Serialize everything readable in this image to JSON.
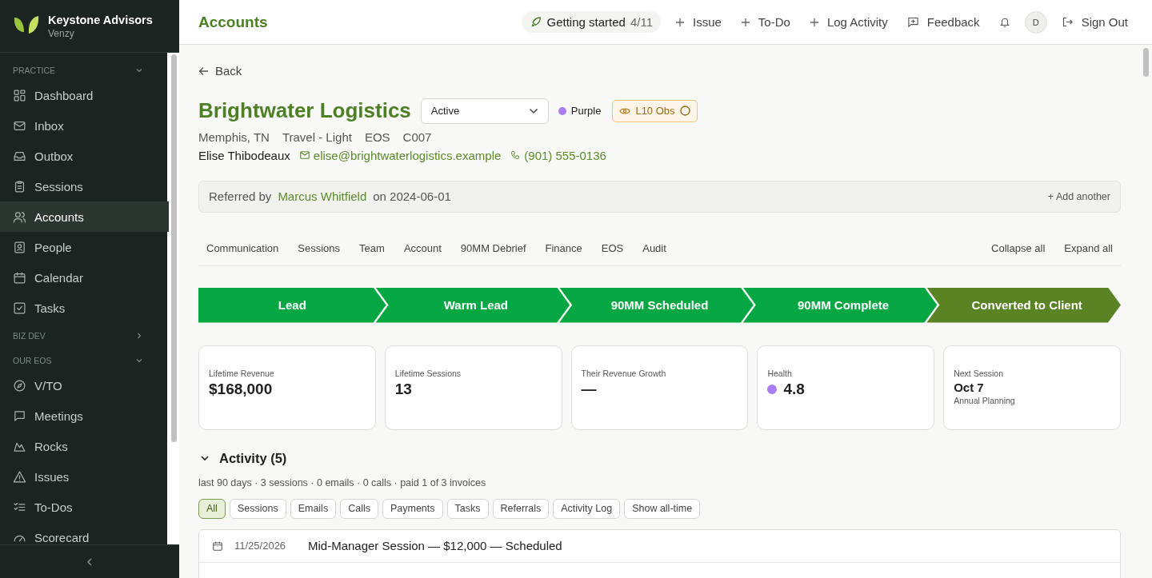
{
  "org": {
    "name": "Keystone Advisors",
    "product": "Venzy"
  },
  "sidebar": {
    "sections": [
      {
        "label": "PRACTICE",
        "expanded": true,
        "items": [
          {
            "label": "Dashboard",
            "selected": false
          },
          {
            "label": "Inbox",
            "selected": false
          },
          {
            "label": "Outbox",
            "selected": false
          },
          {
            "label": "Sessions",
            "selected": false
          },
          {
            "label": "Accounts",
            "selected": true
          },
          {
            "label": "People",
            "selected": false
          },
          {
            "label": "Calendar",
            "selected": false
          },
          {
            "label": "Tasks",
            "selected": false
          }
        ]
      },
      {
        "label": "BIZ DEV",
        "expanded": false
      },
      {
        "label": "OUR EOS",
        "expanded": true,
        "items": [
          {
            "label": "V/TO",
            "selected": false
          },
          {
            "label": "Meetings",
            "selected": false
          },
          {
            "label": "Rocks",
            "selected": false
          },
          {
            "label": "Issues",
            "selected": false
          },
          {
            "label": "To-Dos",
            "selected": false
          },
          {
            "label": "Scorecard",
            "selected": false
          }
        ]
      }
    ]
  },
  "header": {
    "title": "Accounts",
    "getting_started": {
      "label": "Getting started",
      "progress": "4/11"
    },
    "actions": [
      "Issue",
      "To-Do",
      "Log Activity"
    ],
    "feedback": "Feedback",
    "avatar": "D",
    "sign_out": "Sign Out"
  },
  "back": "Back",
  "account": {
    "name": "Brightwater Logistics",
    "status": "Active",
    "tag": {
      "label": "Purple",
      "color": "#a87ef0"
    },
    "badge": "L10 Obs",
    "meta": [
      "Memphis, TN",
      "Travel - Light",
      "EOS",
      "C007"
    ],
    "contact": {
      "name": "Elise Thibodeaux",
      "email": "elise@brightwaterlogistics.example",
      "phone": "(901) 555-0136"
    }
  },
  "referral": {
    "prefix": "Referred by",
    "name": "Marcus Whitfield",
    "date": "on 2024-06-01",
    "add": "+ Add another"
  },
  "section_tabs": [
    "Communication",
    "Sessions",
    "Team",
    "Account",
    "90MM Debrief",
    "Finance",
    "EOS",
    "Audit"
  ],
  "section_actions": [
    "Collapse all",
    "Expand all"
  ],
  "stages": [
    {
      "label": "Lead",
      "selected": false
    },
    {
      "label": "Warm Lead",
      "selected": false
    },
    {
      "label": "90MM Scheduled",
      "selected": false
    },
    {
      "label": "90MM Complete",
      "selected": false
    },
    {
      "label": "Converted to Client",
      "selected": true
    }
  ],
  "stats": [
    {
      "label": "Lifetime Revenue",
      "value": "$168,000"
    },
    {
      "label": "Lifetime Sessions",
      "value": "13"
    },
    {
      "label": "Their Revenue Growth",
      "value": "—"
    },
    {
      "label": "Health",
      "value": "4.8",
      "color": "#a87ef0"
    },
    {
      "label": "Next Session",
      "value": "Oct 7",
      "note": "Annual Planning"
    }
  ],
  "activity": {
    "title": "Activity (5)",
    "expanded": true,
    "summary": "last 90 days · 3 sessions · 0 emails · 0 calls · paid 1 of 3 invoices",
    "filters": [
      {
        "label": "All",
        "selected": true
      },
      {
        "label": "Sessions",
        "selected": false
      },
      {
        "label": "Emails",
        "selected": false
      },
      {
        "label": "Calls",
        "selected": false
      },
      {
        "label": "Payments",
        "selected": false
      },
      {
        "label": "Tasks",
        "selected": false
      },
      {
        "label": "Referrals",
        "selected": false
      },
      {
        "label": "Activity Log",
        "selected": false
      },
      {
        "label": "Show all-time",
        "selected": false
      }
    ],
    "rows": [
      {
        "date": "11/25/2026",
        "text": "Mid-Manager Session — $12,000 — Scheduled"
      }
    ]
  }
}
